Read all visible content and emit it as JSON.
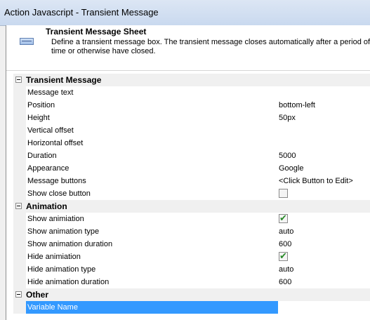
{
  "window": {
    "title": "Action Javascript - Transient Message"
  },
  "header": {
    "title": "Transient Message Sheet",
    "icon": "sheet-icon",
    "description": "Define a transient message box. The transient message closes automatically after a period of time or otherwise have closed."
  },
  "grid": {
    "categories": [
      {
        "label": "Transient Message",
        "rows": [
          {
            "label": "Message text",
            "value": ""
          },
          {
            "label": "Position",
            "value": "bottom-left"
          },
          {
            "label": "Height",
            "value": "50px"
          },
          {
            "label": "Vertical offset",
            "value": ""
          },
          {
            "label": "Horizontal offset",
            "value": ""
          },
          {
            "label": "Duration",
            "value": "5000"
          },
          {
            "label": "Appearance",
            "value": "Google"
          },
          {
            "label": "Message buttons",
            "value": "<Click Button to Edit>"
          },
          {
            "label": "Show close button",
            "checkbox": false
          }
        ]
      },
      {
        "label": "Animation",
        "rows": [
          {
            "label": "Show animiation",
            "checkbox": true
          },
          {
            "label": "Show animation type",
            "value": "auto"
          },
          {
            "label": "Show animation duration",
            "value": "600"
          },
          {
            "label": "Hide animiation",
            "checkbox": true
          },
          {
            "label": "Hide animation type",
            "value": "auto"
          },
          {
            "label": "Hide animation duration",
            "value": "600"
          }
        ]
      },
      {
        "label": "Other",
        "rows": [
          {
            "label": "Variable Name",
            "value": "",
            "selected": true
          }
        ]
      }
    ]
  }
}
